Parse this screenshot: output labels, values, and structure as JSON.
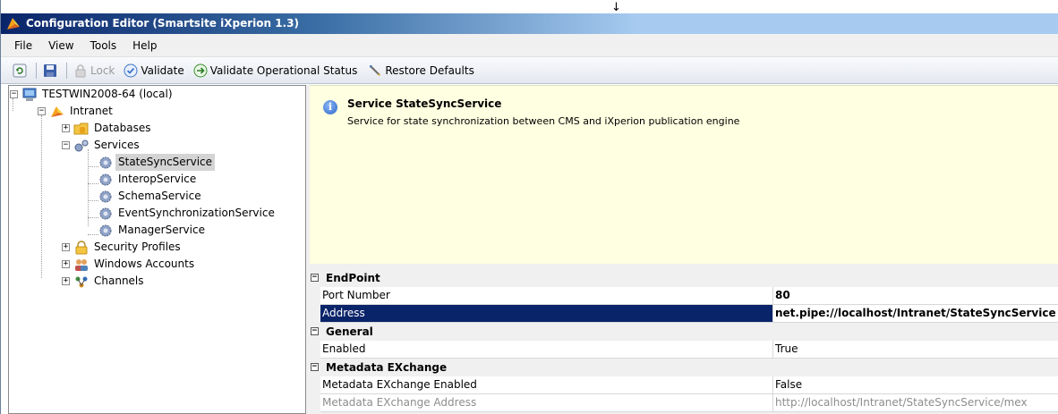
{
  "window": {
    "title": "Configuration Editor (Smartsite iXperion 1.3)"
  },
  "menu": [
    "File",
    "View",
    "Tools",
    "Help"
  ],
  "toolbar": {
    "lock_label": "Lock",
    "validate_label": "Validate",
    "validate_operational_label": "Validate Operational Status",
    "restore_defaults_label": "Restore Defaults"
  },
  "tree": {
    "root": "TESTWIN2008-64 (local)",
    "intranet": "Intranet",
    "databases": "Databases",
    "services": "Services",
    "service_items": [
      "StateSyncService",
      "InteropService",
      "SchemaService",
      "EventSynchronizationService",
      "ManagerService"
    ],
    "security_profiles": "Security Profiles",
    "windows_accounts": "Windows Accounts",
    "channels": "Channels"
  },
  "info": {
    "title": "Service StateSyncService",
    "description": "Service for state synchronization between CMS and iXperion publication engine"
  },
  "properties": {
    "categories": [
      {
        "name": "EndPoint",
        "items": [
          {
            "name": "Port Number",
            "value": "80"
          },
          {
            "name": "Address",
            "value": "net.pipe://localhost/Intranet/StateSyncService"
          }
        ]
      },
      {
        "name": "General",
        "items": [
          {
            "name": "Enabled",
            "value": "True"
          }
        ]
      },
      {
        "name": "Metadata EXchange",
        "items": [
          {
            "name": "Metadata EXchange Enabled",
            "value": "False"
          },
          {
            "name": "Metadata EXchange Address",
            "value": "http://localhost/Intranet/StateSyncService/mex"
          }
        ]
      }
    ]
  },
  "colors": {
    "title_bar": "#0a246a",
    "info_background": "#ffffe1",
    "selection": "#0a246a"
  }
}
